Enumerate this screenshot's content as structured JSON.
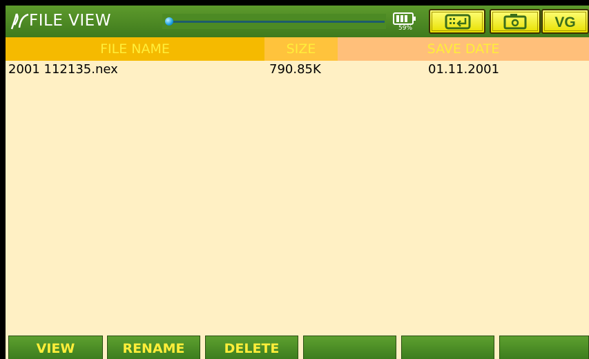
{
  "header": {
    "title": "FILE VIEW",
    "battery": {
      "label": "59%",
      "level": 0.59
    },
    "buttons": {
      "keyboard_icon": "keyboard-enter-icon",
      "camera_icon": "camera-icon",
      "vg_label": "VG"
    },
    "slider": {
      "level": 0.0
    }
  },
  "table": {
    "columns": [
      "FILE NAME",
      "SIZE",
      "SAVE DATE"
    ],
    "rows": [
      {
        "name": "2001 112135.nex",
        "size": "790.85K",
        "date": "01.11.2001"
      }
    ]
  },
  "softkeys": [
    "VIEW",
    "RENAME",
    "DELETE",
    "",
    "",
    ""
  ],
  "colors": {
    "topbar": "#4a8a24",
    "background": "#fff0c4",
    "header_text": "#ffee3a",
    "softkey_text": "#ffee3a"
  }
}
